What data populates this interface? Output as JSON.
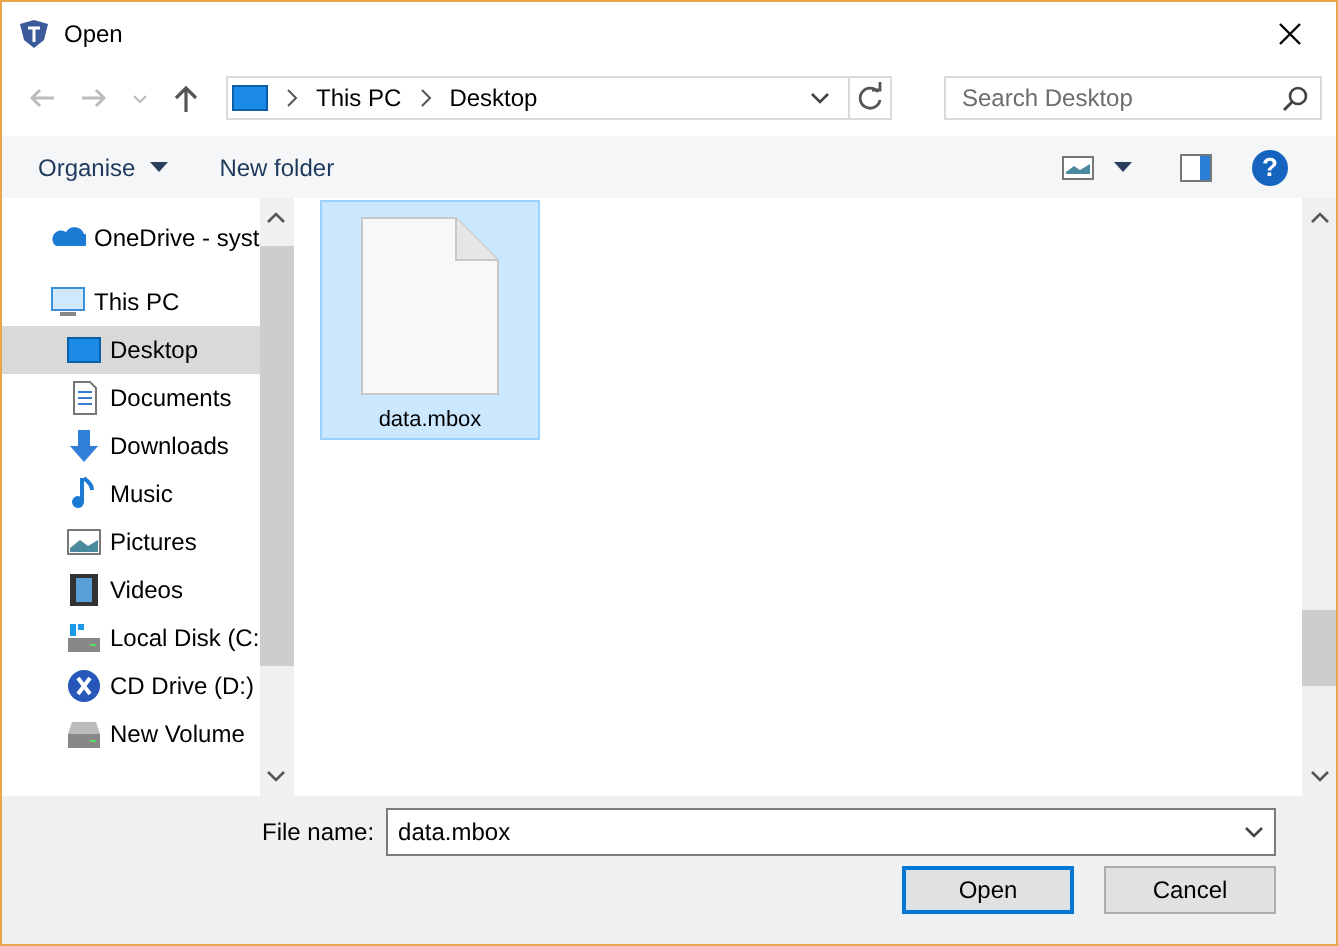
{
  "window": {
    "title": "Open"
  },
  "nav": {
    "path": [
      "This PC",
      "Desktop"
    ],
    "search": {
      "placeholder": "Search Desktop"
    }
  },
  "toolbar": {
    "organise": "Organise",
    "new_folder": "New folder",
    "help": "?"
  },
  "sidebar": {
    "items": [
      {
        "label": "OneDrive - syst",
        "kind": "cloud",
        "selected": false
      },
      {
        "label": "This PC",
        "kind": "pc",
        "selected": false,
        "children": [
          {
            "label": "Desktop",
            "kind": "desktop",
            "selected": true
          },
          {
            "label": "Documents",
            "kind": "documents",
            "selected": false
          },
          {
            "label": "Downloads",
            "kind": "downloads",
            "selected": false
          },
          {
            "label": "Music",
            "kind": "music",
            "selected": false
          },
          {
            "label": "Pictures",
            "kind": "pictures",
            "selected": false
          },
          {
            "label": "Videos",
            "kind": "videos",
            "selected": false
          },
          {
            "label": "Local Disk (C:",
            "kind": "disk",
            "selected": false
          },
          {
            "label": "CD Drive (D:)",
            "kind": "cd",
            "selected": false
          },
          {
            "label": "New Volume",
            "kind": "drive",
            "selected": false
          }
        ]
      }
    ]
  },
  "files": [
    {
      "name": "data.mbox",
      "selected": true
    }
  ],
  "file_name": {
    "label": "File name:",
    "value": "data.mbox"
  },
  "buttons": [
    {
      "label": "Open",
      "default": true
    },
    {
      "label": "Cancel",
      "default": false
    }
  ]
}
